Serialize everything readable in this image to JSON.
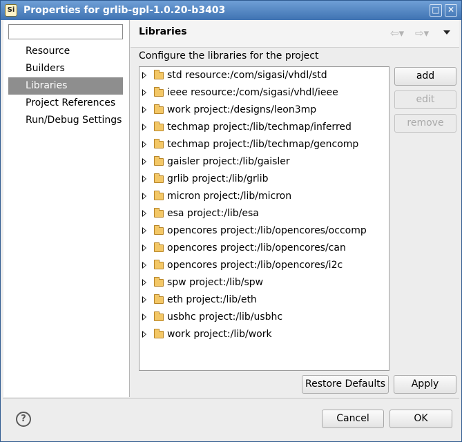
{
  "window": {
    "title": "Properties for grlib-gpl-1.0.20-b3403",
    "app_icon_text": "Si"
  },
  "filter": {
    "value": "",
    "placeholder": ""
  },
  "nav": {
    "items": [
      {
        "label": "Resource",
        "selected": false
      },
      {
        "label": "Builders",
        "selected": false
      },
      {
        "label": "Libraries",
        "selected": true
      },
      {
        "label": "Project References",
        "selected": false
      },
      {
        "label": "Run/Debug Settings",
        "selected": false
      }
    ]
  },
  "page": {
    "title": "Libraries",
    "description": "Configure the libraries for the project",
    "back_glyph": "⇦▾",
    "forward_glyph": "⇨▾"
  },
  "libraries": [
    "std resource:/com/sigasi/vhdl/std",
    "ieee resource:/com/sigasi/vhdl/ieee",
    "work project:/designs/leon3mp",
    "techmap project:/lib/techmap/inferred",
    "techmap project:/lib/techmap/gencomp",
    "gaisler project:/lib/gaisler",
    "grlib project:/lib/grlib",
    "micron project:/lib/micron",
    "esa project:/lib/esa",
    "opencores project:/lib/opencores/occomp",
    "opencores project:/lib/opencores/can",
    "opencores project:/lib/opencores/i2c",
    "spw project:/lib/spw",
    "eth project:/lib/eth",
    "usbhc project:/lib/usbhc",
    "work project:/lib/work"
  ],
  "buttons": {
    "add": "add",
    "edit": "edit",
    "remove": "remove",
    "edit_enabled": false,
    "remove_enabled": false,
    "restore_defaults": "Restore Defaults",
    "apply": "Apply",
    "cancel": "Cancel",
    "ok": "OK"
  },
  "icons": {
    "app": "sigasi-app-icon",
    "maximize": "maximize-icon",
    "close": "close-icon",
    "back": "back-arrow-icon",
    "forward": "forward-arrow-icon",
    "view_menu": "view-menu-icon",
    "tree_expand": "chevron-right-icon",
    "folder": "folder-icon",
    "help": "help-icon"
  },
  "colors": {
    "titlebar": "#4f85c4",
    "selection": "#8e8e8e",
    "folder": "#f3c766"
  }
}
